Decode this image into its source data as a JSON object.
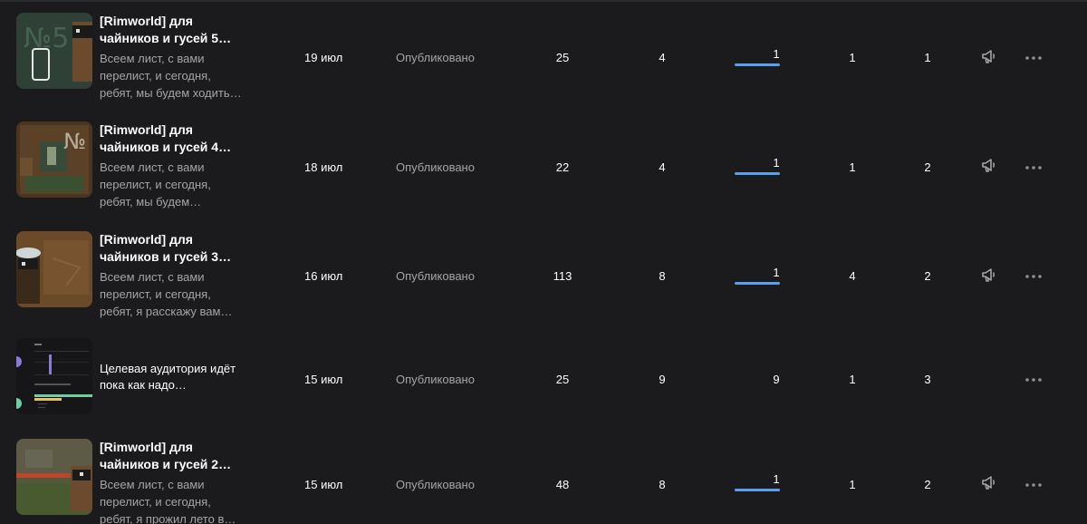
{
  "rows": [
    {
      "title": "[Rimworld] для\nчайников и гусей 5…",
      "snippet": "Всеем лист, с вами\nперелист, и сегодня,\nребят, мы будем ходить…",
      "date": "19 июл",
      "status": "Опубликовано",
      "views": "25",
      "col2": "4",
      "col3": "1",
      "col3_bar_fraction": 1,
      "col4": "1",
      "col5": "1",
      "thumb": "rimworld-5",
      "has_promo": true
    },
    {
      "title": "[Rimworld] для\nчайников и гусей 4…",
      "snippet": "Всеем лист, с вами\nперелист, и сегодня,\nребят, мы будем…",
      "date": "18 июл",
      "status": "Опубликовано",
      "views": "22",
      "col2": "4",
      "col3": "1",
      "col3_bar_fraction": 1,
      "col4": "1",
      "col5": "2",
      "thumb": "rimworld-4",
      "has_promo": true
    },
    {
      "title": "[Rimworld] для\nчайников и гусей 3…",
      "snippet": "Всеем лист, с вами\nперелист, и сегодня,\nребят, я расскажу вам…",
      "date": "16 июл",
      "status": "Опубликовано",
      "views": "113",
      "col2": "8",
      "col3": "1",
      "col3_bar_fraction": 1,
      "col4": "4",
      "col5": "2",
      "thumb": "rimworld-3",
      "has_promo": true
    },
    {
      "title": "Целевая аудитория идёт\nпока как надо…",
      "snippet": "",
      "date": "15 июл",
      "status": "Опубликовано",
      "views": "25",
      "col2": "9",
      "col3": "9",
      "col3_bar_fraction": null,
      "col4": "1",
      "col5": "3",
      "thumb": "audience-stats",
      "has_promo": false
    },
    {
      "title": "[Rimworld] для\nчайников и гусей 2…",
      "snippet": "Всеем лист, с вами\nперелист, и сегодня,\nребят, я прожил лето в…",
      "date": "15 июл",
      "status": "Опубликовано",
      "views": "48",
      "col2": "8",
      "col3": "1",
      "col3_bar_fraction": 1,
      "col4": "1",
      "col5": "2",
      "thumb": "rimworld-2",
      "has_promo": true
    }
  ],
  "icons": {
    "promo": "megaphone-icon",
    "more": "more-dots-icon"
  },
  "colors": {
    "background": "#1b1b1d",
    "muted_text": "#a4a4a8",
    "bar_accent": "#5a9ef0"
  }
}
